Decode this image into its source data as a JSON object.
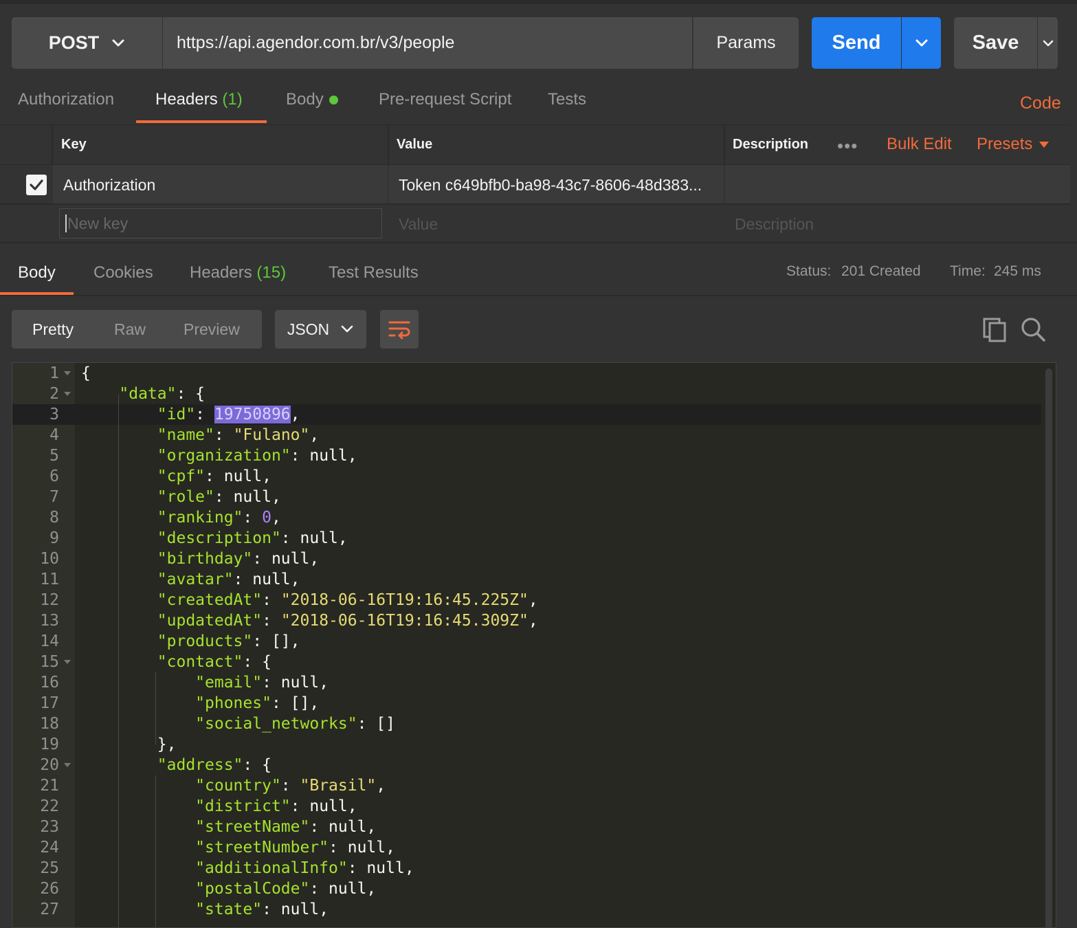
{
  "request": {
    "method": "POST",
    "url": "https://api.agendor.com.br/v3/people",
    "params_label": "Params",
    "send_label": "Send",
    "save_label": "Save"
  },
  "request_tabs": {
    "authorization": "Authorization",
    "headers": "Headers",
    "headers_count": "(1)",
    "body": "Body",
    "prerequest": "Pre-request Script",
    "tests": "Tests",
    "code": "Code"
  },
  "headers_table": {
    "col_key": "Key",
    "col_value": "Value",
    "col_description": "Description",
    "more": "•••",
    "bulk_edit": "Bulk Edit",
    "presets": "Presets",
    "rows": [
      {
        "key": "Authorization",
        "value": "Token c649bfb0-ba98-43c7-8606-48d383...",
        "description": "",
        "checked": true
      }
    ],
    "new_key_placeholder": "New key",
    "value_placeholder": "Value",
    "description_placeholder": "Description"
  },
  "response_tabs": {
    "body": "Body",
    "cookies": "Cookies",
    "headers": "Headers",
    "headers_count": "(15)",
    "test_results": "Test Results"
  },
  "status": {
    "status_label": "Status:",
    "status_value": "201 Created",
    "time_label": "Time:",
    "time_value": "245 ms"
  },
  "view": {
    "pretty": "Pretty",
    "raw": "Raw",
    "preview": "Preview",
    "format": "JSON"
  },
  "icons": [
    "chevron-down-icon",
    "wrap-lines-icon",
    "copy-icon",
    "search-icon",
    "checkmark-icon",
    "fold-arrow-icon"
  ],
  "colors": {
    "accent": "#f26b3a",
    "send_blue": "#1f7aeb",
    "status_green": "#5ec73b",
    "json_key": "#a6e22e",
    "json_string": "#e6db74",
    "json_number": "#ae81ff"
  },
  "code_lines": [
    {
      "n": "1",
      "text": "{"
    },
    {
      "n": "2",
      "text": "    \"data\": {"
    },
    {
      "n": "3",
      "text": "        \"id\": 19750896,"
    },
    {
      "n": "4",
      "text": "        \"name\": \"Fulano\","
    },
    {
      "n": "5",
      "text": "        \"organization\": null,"
    },
    {
      "n": "6",
      "text": "        \"cpf\": null,"
    },
    {
      "n": "7",
      "text": "        \"role\": null,"
    },
    {
      "n": "8",
      "text": "        \"ranking\": 0,"
    },
    {
      "n": "9",
      "text": "        \"description\": null,"
    },
    {
      "n": "10",
      "text": "        \"birthday\": null,"
    },
    {
      "n": "11",
      "text": "        \"avatar\": null,"
    },
    {
      "n": "12",
      "text": "        \"createdAt\": \"2018-06-16T19:16:45.225Z\","
    },
    {
      "n": "13",
      "text": "        \"updatedAt\": \"2018-06-16T19:16:45.309Z\","
    },
    {
      "n": "14",
      "text": "        \"products\": [],"
    },
    {
      "n": "15",
      "text": "        \"contact\": {"
    },
    {
      "n": "16",
      "text": "            \"email\": null,"
    },
    {
      "n": "17",
      "text": "            \"phones\": [],"
    },
    {
      "n": "18",
      "text": "            \"social_networks\": []"
    },
    {
      "n": "19",
      "text": "        },"
    },
    {
      "n": "20",
      "text": "        \"address\": {"
    },
    {
      "n": "21",
      "text": "            \"country\": \"Brasil\","
    },
    {
      "n": "22",
      "text": "            \"district\": null,"
    },
    {
      "n": "23",
      "text": "            \"streetName\": null,"
    },
    {
      "n": "24",
      "text": "            \"streetNumber\": null,"
    },
    {
      "n": "25",
      "text": "            \"additionalInfo\": null,"
    },
    {
      "n": "26",
      "text": "            \"postalCode\": null,"
    },
    {
      "n": "27",
      "text": "            \"state\": null,"
    }
  ]
}
